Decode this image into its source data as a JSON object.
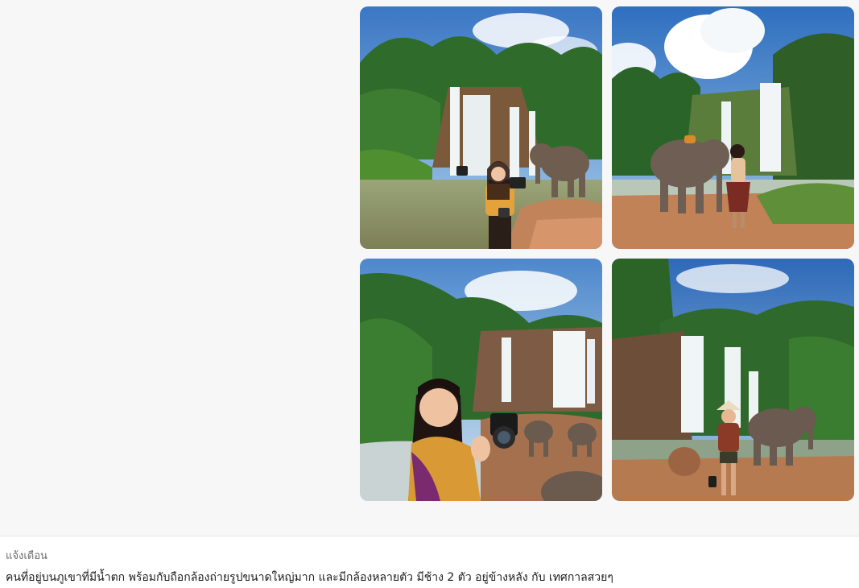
{
  "gallery": {
    "images": [
      {
        "icon": "image-waterfall-woman-elephant"
      },
      {
        "icon": "image-elephant-woman-back"
      },
      {
        "icon": "image-woman-camera-closeup"
      },
      {
        "icon": "image-woman-hat-elephant"
      }
    ]
  },
  "prompt_panel": {
    "label": "แจ้งเตือน",
    "text": "คนที่อยู่บนภูเขาที่มีน้ำตก พร้อมกับถือกล้องถ่ายรูปขนาดใหญ่มาก และมีกล้องหลายตัว มีช้าง 2 ตัว อยู่ข้างหลัง กับ เทศกาลสวยๆ"
  },
  "colors": {
    "background": "#f7f7f7",
    "panel": "#ffffff",
    "sky": "#4a86c8",
    "foliage": "#2f6b2a",
    "water": "#e8f0f2",
    "rock": "#b0744a",
    "elephant": "#6b5a4e"
  }
}
